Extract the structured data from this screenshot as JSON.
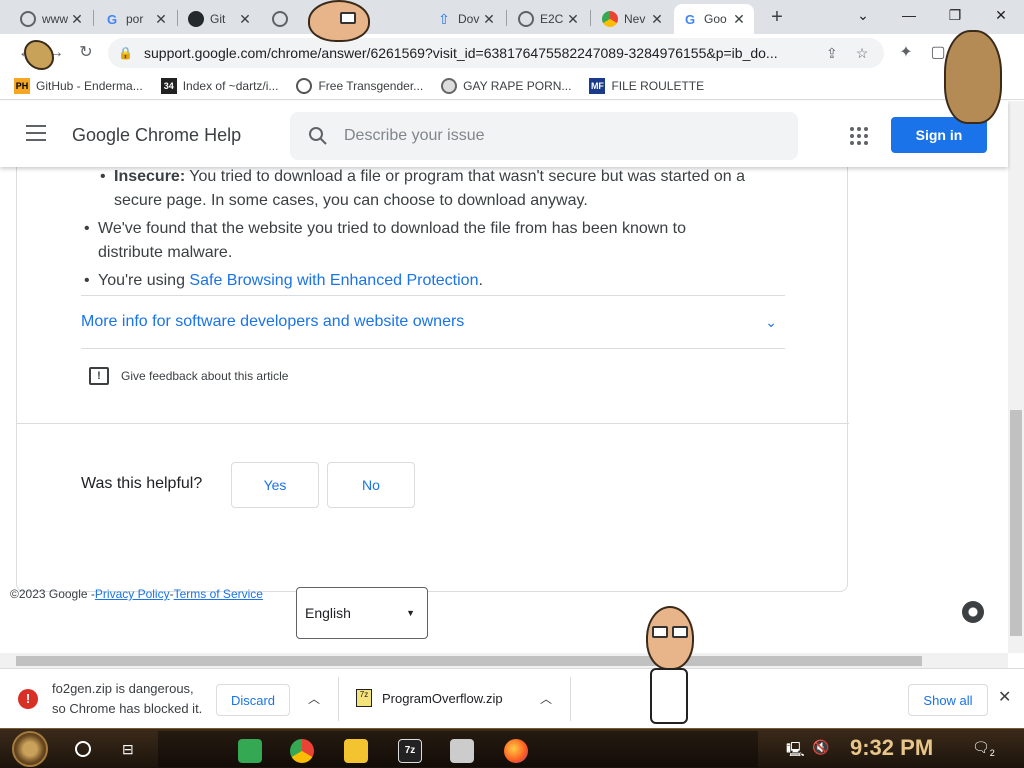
{
  "tabs": [
    {
      "title": "www",
      "icon": "globe-icon",
      "active": false
    },
    {
      "title": "por",
      "icon": "google-g-icon",
      "active": false
    },
    {
      "title": "Git",
      "icon": "github-icon",
      "active": false
    },
    {
      "title": "",
      "icon": "site-icon",
      "active": false
    },
    {
      "title": "Dov",
      "icon": "upload-arrow-icon",
      "active": false
    },
    {
      "title": "E2C",
      "icon": "globe-icon",
      "active": false
    },
    {
      "title": "Nev",
      "icon": "chrome-icon",
      "active": false
    },
    {
      "title": "Goo",
      "icon": "google-g-icon",
      "active": true
    }
  ],
  "toolbar": {
    "url": "support.google.com/chrome/answer/6261569?visit_id=638176475582247089-3284976155&p=ib_do..."
  },
  "bookmarks": [
    {
      "label": "GitHub - Enderma...",
      "icon_text": "PH",
      "icon_color": "#f5a623"
    },
    {
      "label": "Index of ~dartz/i...",
      "icon_text": "34",
      "icon_color": "#222222"
    },
    {
      "label": "Free Transgender...",
      "icon_text": "",
      "icon_color": "#555555"
    },
    {
      "label": "GAY RAPE PORN...",
      "icon_text": "",
      "icon_color": "#666666"
    },
    {
      "label": "FILE ROULETTE",
      "icon_text": "MF",
      "icon_color": "#1a3a8a"
    }
  ],
  "header": {
    "title": "Google Chrome Help",
    "search_placeholder": "Describe your issue",
    "sign_in": "Sign in"
  },
  "article": {
    "bullet_1_strong": "Insecure:",
    "bullet_1_text": "You tried to download a file or program that wasn't secure but was started on a",
    "bullet_1_text_2": "secure page. In some cases, you can choose to download anyway.",
    "bullet_2_line_1": "We've found that the website you tried to download the file from has been known to",
    "bullet_2_line_2": "distribute malware.",
    "bullet_3_prefix": "You're using ",
    "bullet_3_link": "Safe Browsing with Enhanced Protection",
    "bullet_3_suffix": ".",
    "more_info": "More info for software developers and website owners",
    "feedback": "Give feedback about this article",
    "helpful_question": "Was this helpful?",
    "yes": "Yes",
    "no": "No"
  },
  "footer": {
    "copyright": "©2023 Google -",
    "privacy": "Privacy Policy",
    "sep": " -",
    "terms": "Terms of Service",
    "language": "English"
  },
  "download_shelf": {
    "danger_line_1": "fo2gen.zip is dangerous,",
    "danger_line_2": "so Chrome has blocked it.",
    "discard": "Discard",
    "file_name": "ProgramOverflow.zip",
    "show_all": "Show all"
  },
  "taskbar": {
    "time": "9:32 PM",
    "notification_count": "2"
  },
  "colors": {
    "accent": "#1a73e8",
    "danger": "#d93025"
  }
}
